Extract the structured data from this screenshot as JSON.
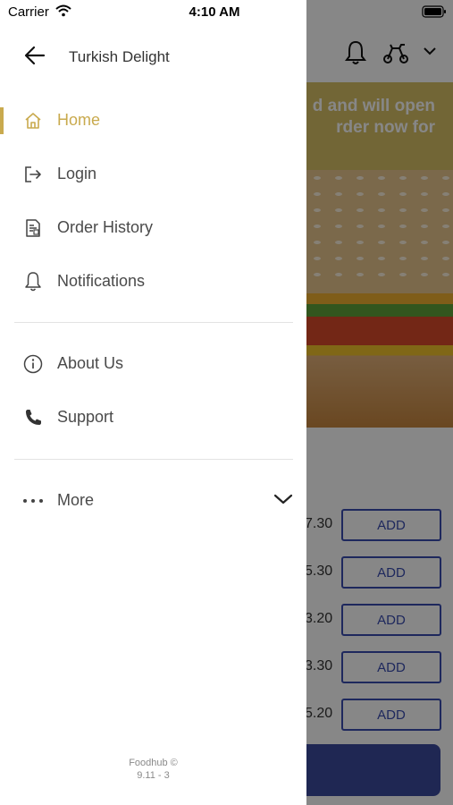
{
  "status_bar": {
    "carrier": "Carrier",
    "time": "4:10 AM"
  },
  "drawer": {
    "store_name": "Turkish Delight",
    "primary_items": [
      {
        "label": "Home",
        "icon": "home-icon",
        "active": true
      },
      {
        "label": "Login",
        "icon": "login-icon",
        "active": false
      },
      {
        "label": "Order History",
        "icon": "order-history-icon",
        "active": false
      },
      {
        "label": "Notifications",
        "icon": "bell-icon",
        "active": false
      }
    ],
    "secondary_items": [
      {
        "label": "About Us",
        "icon": "info-icon"
      },
      {
        "label": "Support",
        "icon": "phone-icon"
      }
    ],
    "more_label": "More",
    "footer_line1": "Foodhub ©",
    "footer_line2": "9.11 - 3"
  },
  "background": {
    "banner_line1": "d and will open",
    "banner_line2": "rder now for",
    "prices": [
      ".30",
      ".30",
      ".20",
      ".30",
      ".20"
    ],
    "price_prefixes": [
      "7",
      "5",
      "3",
      "3",
      "5"
    ],
    "add_label": "ADD"
  },
  "colors": {
    "accent": "#c9aa4e",
    "add_button": "#3a4db0",
    "banner": "#d8c067",
    "cart_bar": "#3c4a9e"
  }
}
